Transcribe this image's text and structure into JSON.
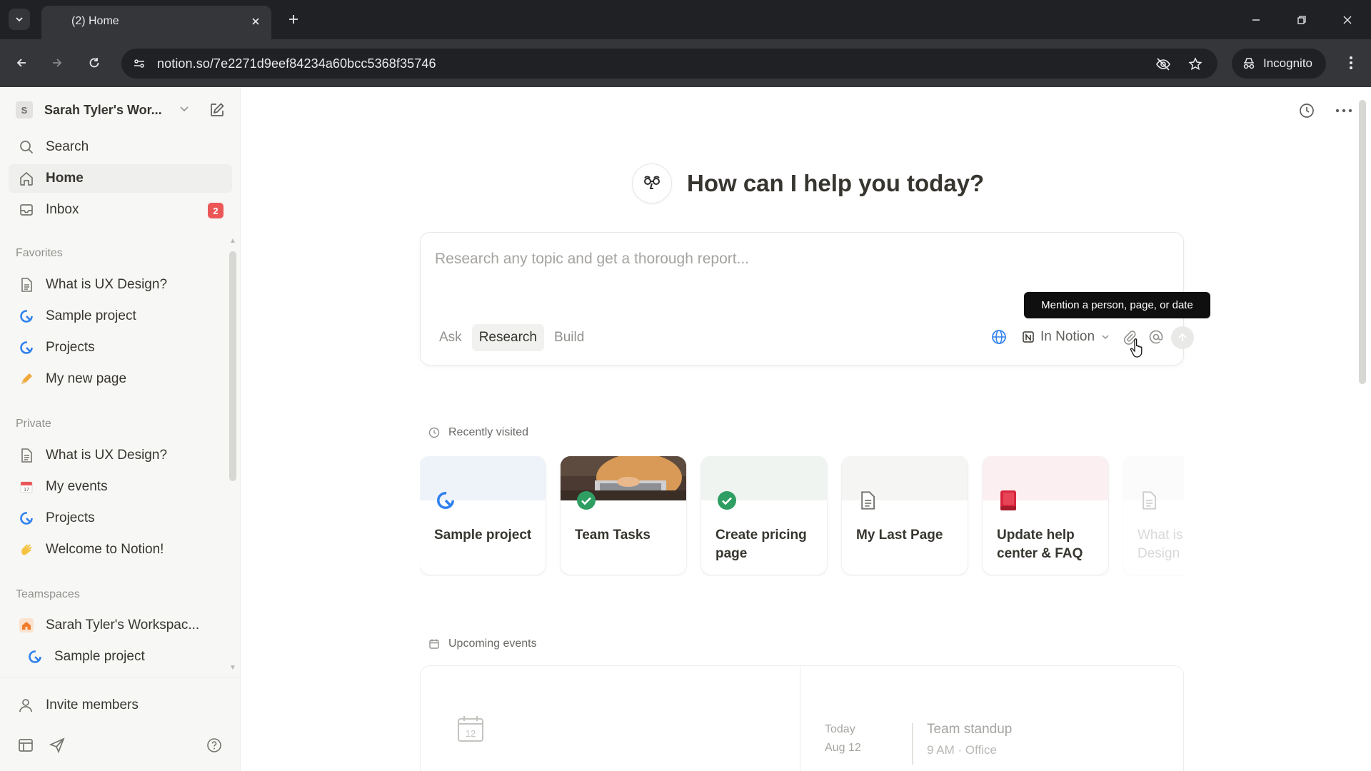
{
  "browser": {
    "tab_title": "(2) Home",
    "url": "notion.so/7e2271d9eef84234a60bcc5368f35746",
    "incognito_label": "Incognito"
  },
  "sidebar": {
    "workspace_initial": "S",
    "workspace_name": "Sarah Tyler's Wor...",
    "top_items": [
      {
        "label": "Search",
        "icon": "search-icon"
      },
      {
        "label": "Home",
        "icon": "home-icon",
        "active": true
      },
      {
        "label": "Inbox",
        "icon": "inbox-icon",
        "badge": "2"
      }
    ],
    "favorites_label": "Favorites",
    "favorites": [
      {
        "label": "What is UX Design?",
        "icon": "page-icon"
      },
      {
        "label": "Sample project",
        "icon": "project-icon"
      },
      {
        "label": "Projects",
        "icon": "project-icon"
      },
      {
        "label": "My new page",
        "icon": "pencil-icon"
      }
    ],
    "private_label": "Private",
    "private": [
      {
        "label": "What is UX Design?",
        "icon": "page-icon"
      },
      {
        "label": "My events",
        "icon": "calendar-icon"
      },
      {
        "label": "Projects",
        "icon": "project-icon"
      },
      {
        "label": "Welcome to Notion!",
        "icon": "wave-icon"
      }
    ],
    "teamspaces_label": "Teamspaces",
    "teamspaces": [
      {
        "label": "Sarah Tyler's Workspac...",
        "icon": "house-icon"
      },
      {
        "label": "Sample project",
        "icon": "project-icon"
      }
    ],
    "invite_label": "Invite members"
  },
  "main": {
    "hero_title": "How can I help you today?",
    "prompt_placeholder": "Research any topic and get a thorough report...",
    "modes": [
      "Ask",
      "Research",
      "Build"
    ],
    "active_mode": "Research",
    "source_label": "In Notion",
    "tooltip": "Mention a person, page, or date",
    "recent_label": "Recently visited",
    "recent": [
      {
        "title": "Sample project",
        "icon": "project-icon"
      },
      {
        "title": "Team Tasks",
        "icon": "check-icon"
      },
      {
        "title": "Create pricing page",
        "icon": "check-icon"
      },
      {
        "title": "My Last Page",
        "icon": "page-icon"
      },
      {
        "title": "Update help center & FAQ",
        "icon": "book-icon"
      },
      {
        "title": "What is UX Design",
        "icon": "page-icon"
      }
    ],
    "events_label": "Upcoming events",
    "calendar_day": "12",
    "event": {
      "day": "Today",
      "date": "Aug 12",
      "title": "Team standup",
      "meta": "9 AM · Office"
    }
  },
  "colors": {
    "badge": "#eb5757",
    "sidebar_bg": "#f7f7f5",
    "chrome_dark": "#202124",
    "chrome_toolbar": "#35363a"
  }
}
